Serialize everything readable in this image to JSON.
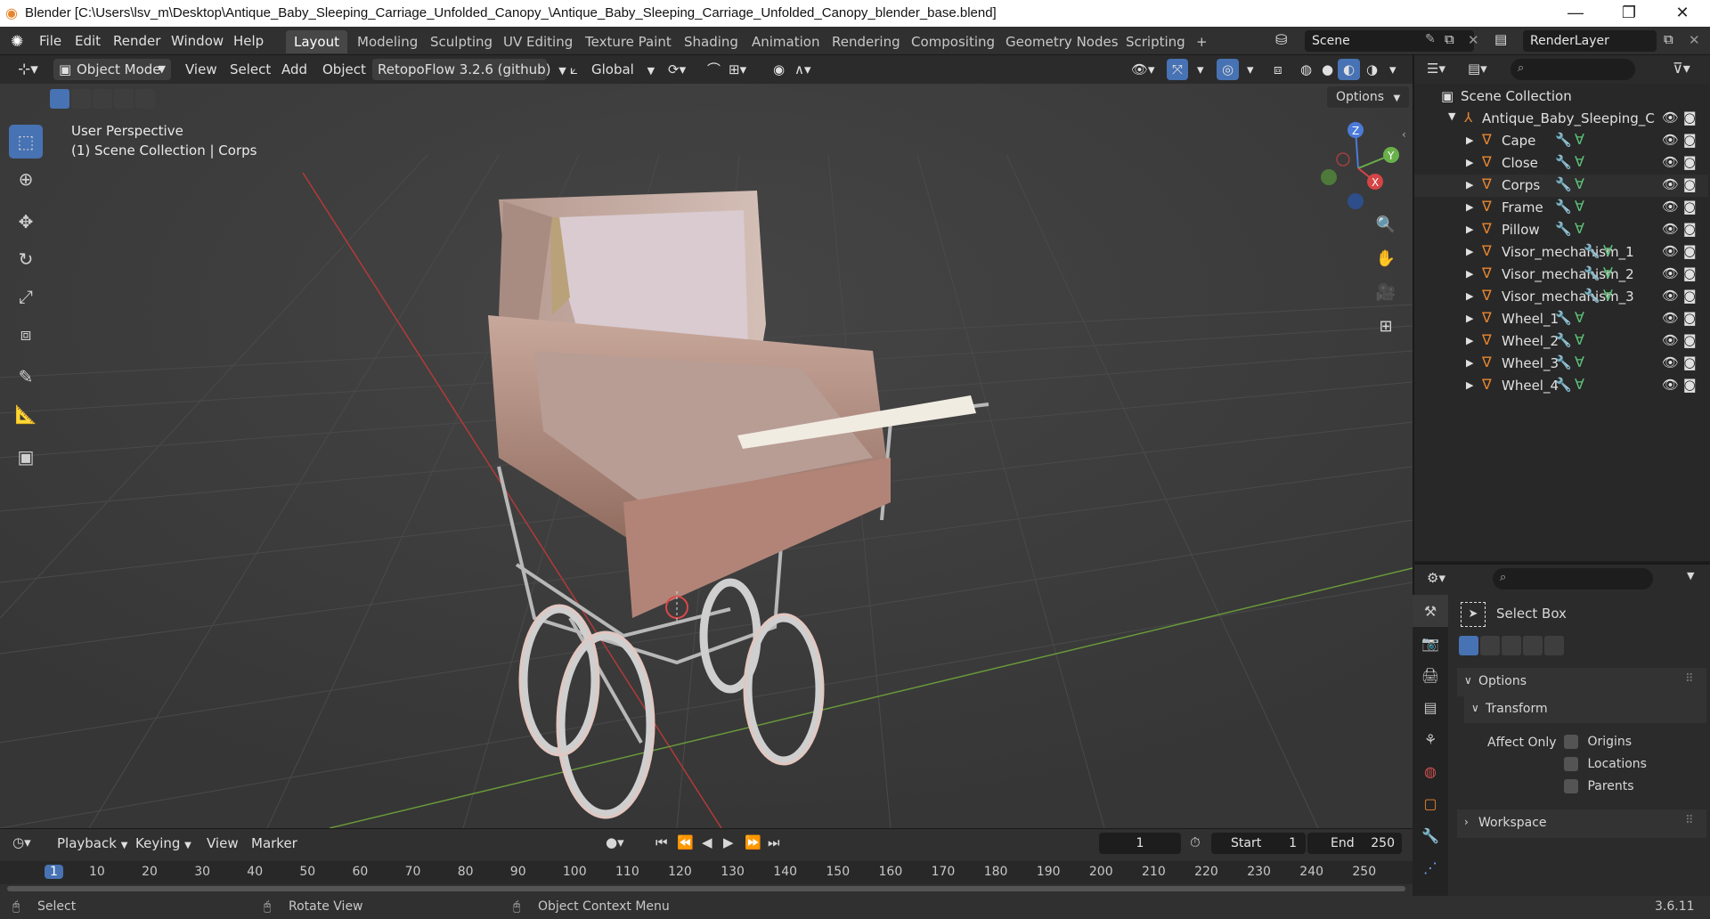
{
  "titlebar": {
    "title": "Blender [C:\\Users\\lsv_m\\Desktop\\Antique_Baby_Sleeping_Carriage_Unfolded_Canopy_\\Antique_Baby_Sleeping_Carriage_Unfolded_Canopy_blender_base.blend]",
    "min": "—",
    "max": "❐",
    "close": "✕"
  },
  "menu": {
    "file": "File",
    "edit": "Edit",
    "render": "Render",
    "window": "Window",
    "help": "Help"
  },
  "workspaces": [
    "Layout",
    "Modeling",
    "Sculpting",
    "UV Editing",
    "Texture Paint",
    "Shading",
    "Animation",
    "Rendering",
    "Compositing",
    "Geometry Nodes",
    "Scripting"
  ],
  "add_tab": "+",
  "scene": {
    "name": "Scene",
    "view_layer": "RenderLayer"
  },
  "viewport_header": {
    "mode": "Object Mode",
    "view": "View",
    "select": "Select",
    "add": "Add",
    "object": "Object",
    "addon": "RetopoFlow 3.2.6 (github)",
    "orientation": "Global",
    "options": "Options"
  },
  "viewport": {
    "perspective": "User Perspective",
    "collection_info": "(1) Scene Collection | Corps"
  },
  "gizmo": {
    "z": "Z",
    "y": "Y",
    "x": "X"
  },
  "outliner": {
    "root": "Scene Collection",
    "collection": "Antique_Baby_Sleeping_C",
    "objects": [
      "Cape",
      "Close",
      "Corps",
      "Frame",
      "Pillow",
      "Visor_mechanism_1",
      "Visor_mechanism_2",
      "Visor_mechanism_3",
      "Wheel_1",
      "Wheel_2",
      "Wheel_3",
      "Wheel_4"
    ]
  },
  "properties": {
    "tool_name": "Select Box",
    "options": "Options",
    "transform": "Transform",
    "affect_only": "Affect Only",
    "origins": "Origins",
    "locations": "Locations",
    "parents": "Parents",
    "workspace": "Workspace"
  },
  "timeline": {
    "playback": "Playback",
    "keying": "Keying",
    "view": "View",
    "marker": "Marker",
    "current_frame": "1",
    "start_label": "Start",
    "start": "1",
    "end_label": "End",
    "end": "250",
    "ticks": [
      "1",
      "10",
      "20",
      "30",
      "40",
      "50",
      "60",
      "70",
      "80",
      "90",
      "100",
      "110",
      "120",
      "130",
      "140",
      "150",
      "160",
      "170",
      "180",
      "190",
      "200",
      "210",
      "220",
      "230",
      "240",
      "250"
    ]
  },
  "status": {
    "select": "Select",
    "rotate": "Rotate View",
    "context": "Object Context Menu",
    "version": "3.6.11"
  },
  "colors": {
    "accent": "#4772b3",
    "object_orange": "#e8862f",
    "mesh_green": "#5fc57a",
    "modifier_blue": "#6fa8ff"
  }
}
